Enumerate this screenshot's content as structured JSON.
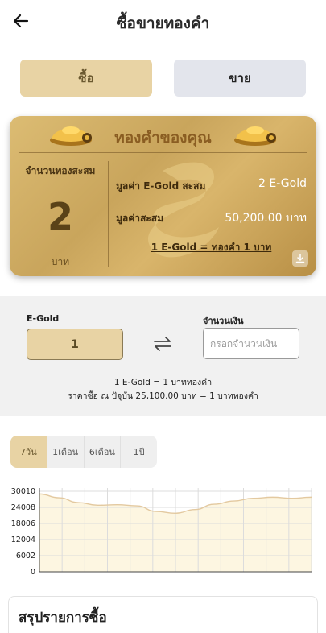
{
  "header": {
    "title": "ซื้อขายทองคำ"
  },
  "tabs": {
    "buy_label": "ซื้อ",
    "sell_label": "ขาย"
  },
  "card": {
    "title": "ทองคำของคุณ",
    "accumulated_label": "จำนวนทองสะสม",
    "accumulated_value": "2",
    "accumulated_unit": "บาท",
    "egold_label": "มูลค่า E-Gold สะสม",
    "egold_value": "2 E-Gold",
    "value_label": "มูลค่าสะสม",
    "value_amount": "50,200.00 บาท",
    "rate_text": "1 E-Gold = ทองคำ 1 บาท"
  },
  "calculator": {
    "egold_label": "E-Gold",
    "egold_value": "1",
    "amount_label": "จำนวนเงิน",
    "amount_placeholder": "กรอกจำนวนเงิน",
    "note_line1": "1 E-Gold = 1 บาททองคำ",
    "note_line2": "ราคาซื้อ ณ ปัจุบัน 25,100.00 บาท = 1 บาททองคำ"
  },
  "periods": [
    {
      "label": "7วัน",
      "active": true
    },
    {
      "label": "1เดือน",
      "active": false
    },
    {
      "label": "6เดือน",
      "active": false
    },
    {
      "label": "1ปี",
      "active": false
    }
  ],
  "chart_data": {
    "type": "area",
    "y_ticks": [
      "30010",
      "24008",
      "18006",
      "12004",
      "6002",
      "0"
    ],
    "ylim": [
      0,
      30010
    ],
    "x": [
      0,
      1,
      2,
      3,
      4,
      5,
      6,
      7,
      8,
      9,
      10,
      11,
      12,
      13,
      14
    ],
    "values": [
      29000,
      27600,
      25800,
      24800,
      25000,
      24600,
      22500,
      21800,
      23200,
      25200,
      26400,
      27400,
      27800,
      27400,
      27800
    ],
    "grid": true,
    "colors": {
      "line": "#e3c9a0",
      "fill": "#fdf6e1",
      "grid": "#dcdcdc"
    }
  },
  "summary": {
    "title": "สรุปรายการซื้อ"
  },
  "colors": {
    "gold_light": "#e8d3a4",
    "gold_dark": "#c9a55c",
    "sell_tab": "#e3e5ec"
  }
}
